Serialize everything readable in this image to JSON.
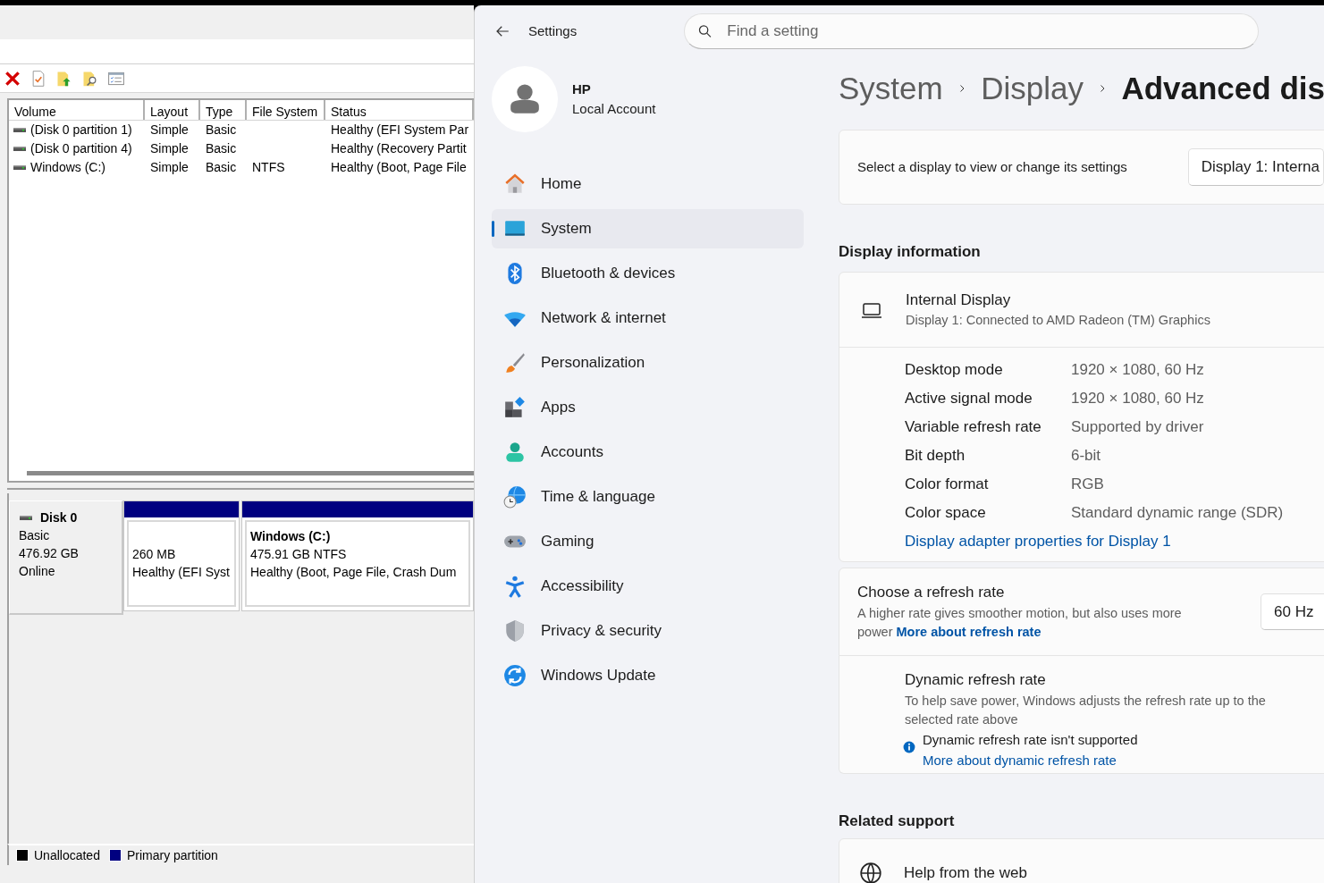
{
  "disk_management": {
    "volume_table": {
      "columns": [
        "Volume",
        "Layout",
        "Type",
        "File System",
        "Status"
      ],
      "rows": [
        {
          "volume": "(Disk 0 partition 1)",
          "layout": "Simple",
          "type": "Basic",
          "status": "Healthy (EFI System Par"
        },
        {
          "volume": "(Disk 0 partition 4)",
          "layout": "Simple",
          "type": "Basic",
          "status": "Healthy (Recovery Partit"
        },
        {
          "volume": "Windows (C:)",
          "layout": "Simple",
          "type": "Basic",
          "file_system": "NTFS",
          "status": "Healthy (Boot, Page File"
        }
      ]
    },
    "disk": {
      "name": "Disk 0",
      "type": "Basic",
      "size": "476.92 GB",
      "state": "Online"
    },
    "partitions": [
      {
        "size": "260 MB",
        "status": "Healthy (EFI Syst"
      },
      {
        "title": "Windows  (C:)",
        "size": "475.91 GB NTFS",
        "status": "Healthy (Boot, Page File, Crash Dum"
      }
    ],
    "legend": [
      {
        "label": "Unallocated",
        "color": "#000000"
      },
      {
        "label": "Primary partition",
        "color": "#000080"
      }
    ]
  },
  "settings": {
    "title": "Settings",
    "search": {
      "placeholder": "Find a setting"
    },
    "account": {
      "name": "HP",
      "type": "Local Account"
    },
    "nav": [
      {
        "label": "Home",
        "selected": false
      },
      {
        "label": "System",
        "selected": true
      },
      {
        "label": "Bluetooth & devices",
        "selected": false
      },
      {
        "label": "Network & internet",
        "selected": false
      },
      {
        "label": "Personalization",
        "selected": false
      },
      {
        "label": "Apps",
        "selected": false
      },
      {
        "label": "Accounts",
        "selected": false
      },
      {
        "label": "Time & language",
        "selected": false
      },
      {
        "label": "Gaming",
        "selected": false
      },
      {
        "label": "Accessibility",
        "selected": false
      },
      {
        "label": "Privacy & security",
        "selected": false
      },
      {
        "label": "Windows Update",
        "selected": false
      }
    ],
    "breadcrumb": [
      "System",
      "Display",
      "Advanced dis"
    ],
    "display_select": {
      "label": "Select a display to view or change its settings",
      "value": "Display 1: Interna"
    },
    "display_information": {
      "heading": "Display information",
      "name": "Internal Display",
      "subtitle": "Display 1: Connected to AMD Radeon (TM) Graphics",
      "details": [
        {
          "label": "Desktop mode",
          "value": "1920 × 1080, 60 Hz"
        },
        {
          "label": "Active signal mode",
          "value": "1920 × 1080, 60 Hz"
        },
        {
          "label": "Variable refresh rate",
          "value": "Supported by driver"
        },
        {
          "label": "Bit depth",
          "value": "6-bit"
        },
        {
          "label": "Color format",
          "value": "RGB"
        },
        {
          "label": "Color space",
          "value": "Standard dynamic range (SDR)"
        }
      ],
      "link": "Display adapter properties for Display 1"
    },
    "refresh_rate": {
      "title": "Choose a refresh rate",
      "description": "A higher rate gives smoother motion, but also uses more power",
      "link": "More about refresh rate",
      "value": "60 Hz"
    },
    "dynamic_refresh": {
      "title": "Dynamic refresh rate",
      "description": "To help save power, Windows adjusts the refresh rate up to the selected rate above",
      "notice": "Dynamic refresh rate isn't supported",
      "link": "More about dynamic refresh rate"
    },
    "related_support": {
      "heading": "Related support",
      "items": [
        {
          "label": "Help from the web"
        }
      ]
    }
  }
}
